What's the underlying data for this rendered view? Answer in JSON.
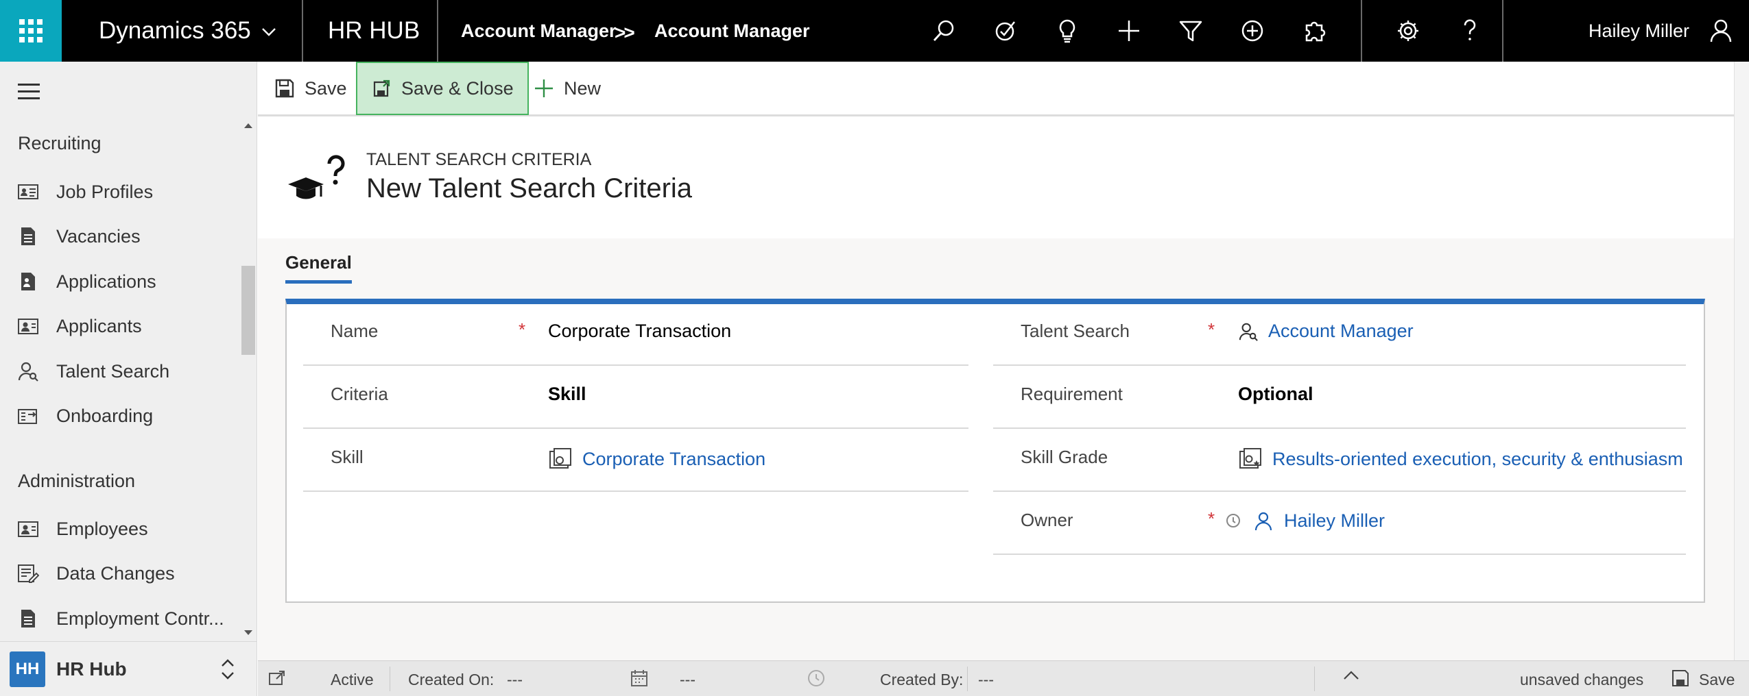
{
  "topbar": {
    "app_name": "Dynamics 365",
    "hub_name": "HR HUB",
    "breadcrumb": [
      "Account Manager",
      "Account Manager"
    ],
    "breadcrumb_sep": ">>",
    "icons": [
      "search-icon",
      "task-icon",
      "lightbulb-icon",
      "plus-icon",
      "filter-icon",
      "add-circle-icon",
      "puzzle-icon",
      "settings-icon",
      "help-icon"
    ],
    "user_name": "Hailey Miller"
  },
  "sidebar": {
    "sections": [
      {
        "title": "Recruiting",
        "items": [
          {
            "label": "Job Profiles",
            "icon": "profile-card-icon"
          },
          {
            "label": "Vacancies",
            "icon": "document-icon"
          },
          {
            "label": "Applications",
            "icon": "application-icon"
          },
          {
            "label": "Applicants",
            "icon": "contact-card-icon"
          },
          {
            "label": "Talent Search",
            "icon": "talent-search-icon"
          },
          {
            "label": "Onboarding",
            "icon": "onboarding-icon"
          }
        ]
      },
      {
        "title": "Administration",
        "items": [
          {
            "label": "Employees",
            "icon": "contact-card-icon"
          },
          {
            "label": "Data Changes",
            "icon": "data-changes-icon"
          },
          {
            "label": "Employment Contr...",
            "icon": "document-icon"
          }
        ]
      }
    ],
    "area": {
      "initials": "HH",
      "label": "HR Hub"
    }
  },
  "commandbar": {
    "save": "Save",
    "save_close": "Save & Close",
    "new": "New"
  },
  "header": {
    "entity": "TALENT SEARCH CRITERIA",
    "title": "New Talent Search Criteria"
  },
  "form": {
    "tab": "General",
    "left": [
      {
        "label": "Name",
        "required": "*",
        "value": "Corporate Transaction"
      },
      {
        "label": "Criteria",
        "required": "",
        "value": "Skill"
      },
      {
        "label": "Skill",
        "required": "",
        "value": "Corporate Transaction"
      }
    ],
    "right": [
      {
        "label": "Talent Search",
        "required": "*",
        "value": "Account Manager"
      },
      {
        "label": "Requirement",
        "required": "",
        "value": "Optional"
      },
      {
        "label": "Skill Grade",
        "required": "",
        "value": "Results-oriented execution, security & enthusiasm"
      },
      {
        "label": "Owner",
        "required": "*",
        "value": "Hailey Miller"
      }
    ]
  },
  "footer": {
    "status": "Active",
    "created_on_label": "Created On:",
    "created_on_value": "---",
    "time_value": "---",
    "created_by_label": "Created By:",
    "created_by_value": "---",
    "unsaved": "unsaved changes",
    "save": "Save"
  },
  "colors": {
    "topbar": "#000000",
    "waffle": "#0aa7bd",
    "link": "#1a5fb4",
    "accent": "#2a6ebd",
    "required": "#d13438",
    "save_close_bg": "#cdebd3",
    "save_close_border": "#45b35e"
  }
}
